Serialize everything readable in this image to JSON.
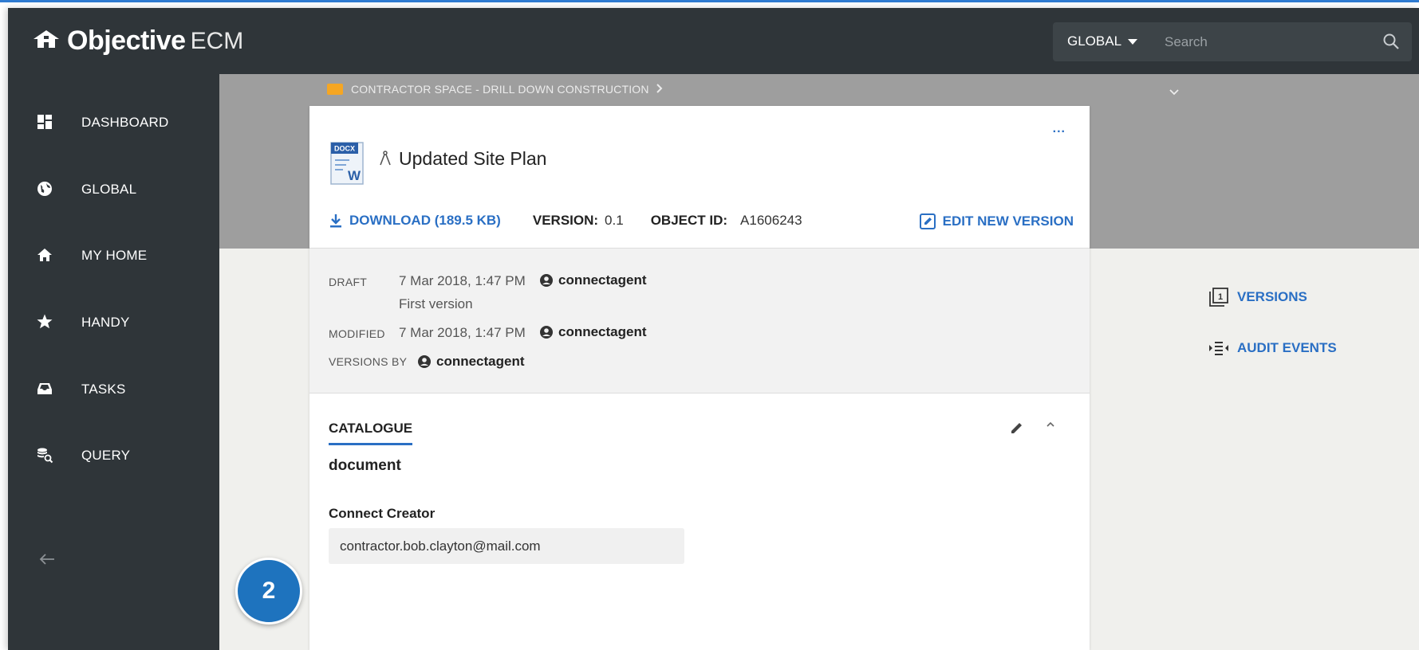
{
  "app": {
    "brand_bold": "Objective",
    "brand_light": "ECM"
  },
  "search": {
    "scope": "GLOBAL",
    "placeholder": "Search"
  },
  "sidebar": {
    "items": [
      {
        "label": "DASHBOARD",
        "icon": "dashboard-icon"
      },
      {
        "label": "GLOBAL",
        "icon": "globe-icon"
      },
      {
        "label": "MY HOME",
        "icon": "home-icon"
      },
      {
        "label": "HANDY",
        "icon": "star-icon"
      },
      {
        "label": "TASKS",
        "icon": "inbox-icon"
      },
      {
        "label": "QUERY",
        "icon": "query-icon"
      }
    ]
  },
  "breadcrumb": {
    "path": "CONTRACTOR SPACE - DRILL DOWN CONSTRUCTION"
  },
  "document": {
    "file_type": "DOCX",
    "title": "Updated Site Plan",
    "download_label": "DOWNLOAD (189.5 KB)",
    "version_label": "VERSION:",
    "version_value": "0.1",
    "object_id_label": "OBJECT ID:",
    "object_id_value": "A1606243",
    "edit_label": "EDIT NEW VERSION",
    "more_label": "..."
  },
  "properties": {
    "draft_label": "DRAFT",
    "draft_date": "7 Mar 2018, 1:47 PM",
    "draft_user": "connectagent",
    "draft_note": "First version",
    "modified_label": "MODIFIED",
    "modified_date": "7 Mar 2018, 1:47 PM",
    "modified_user": "connectagent",
    "versions_by_label": "VERSIONS BY",
    "versions_by_user": "connectagent"
  },
  "catalogue": {
    "tab_label": "CATALOGUE",
    "doc_type": "document",
    "field_label": "Connect Creator",
    "field_value": "contractor.bob.clayton@mail.com"
  },
  "right_links": {
    "versions": "VERSIONS",
    "audit": "AUDIT EVENTS"
  },
  "step_badge": "2",
  "colors": {
    "accent": "#2a6fc4",
    "header_bg": "#2f3539",
    "folder": "#f5a623",
    "badge": "#1e73be"
  }
}
